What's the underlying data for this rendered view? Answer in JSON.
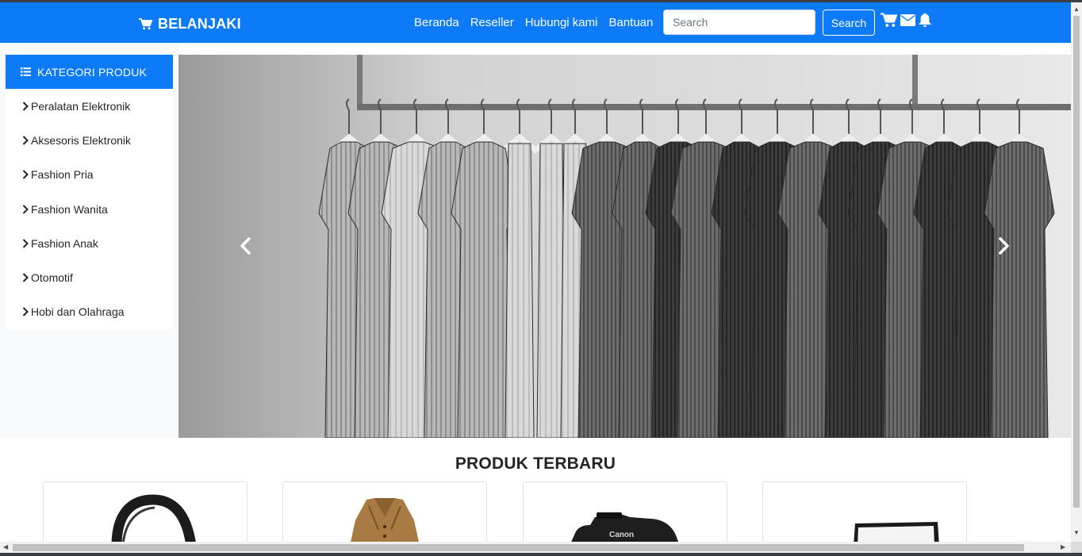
{
  "colors": {
    "primary": "#0d7bf7",
    "sidebar_bg": "#f8f9fa"
  },
  "brand": {
    "name": "BELANJAKI",
    "icon": "cart-icon"
  },
  "nav": {
    "links": [
      "Beranda",
      "Reseller",
      "Hubungi kami",
      "Bantuan"
    ],
    "search_placeholder": "Search",
    "search_value": "",
    "search_button": "Search",
    "icons": [
      "cart-icon",
      "envelope-icon",
      "bell-icon"
    ]
  },
  "sidebar": {
    "title": "KATEGORI PRODUK",
    "title_icon": "list-icon",
    "items": [
      {
        "label": "Peralatan Elektronik"
      },
      {
        "label": "Aksesoris Elektronik"
      },
      {
        "label": "Fashion Pria"
      },
      {
        "label": "Fashion Wanita"
      },
      {
        "label": "Fashion Anak"
      },
      {
        "label": "Otomotif"
      },
      {
        "label": "Hobi dan Olahraga"
      }
    ]
  },
  "carousel": {
    "image": "clothes-rack-photo",
    "prev_icon": "chevron-left-icon",
    "next_icon": "chevron-right-icon"
  },
  "products_section": {
    "title": "PRODUK TERBARU",
    "cards": [
      {
        "image": "headphones-image"
      },
      {
        "image": "jacket-image"
      },
      {
        "image": "camera-image",
        "brand_text": "Canon"
      },
      {
        "image": "laptop-image"
      }
    ]
  }
}
